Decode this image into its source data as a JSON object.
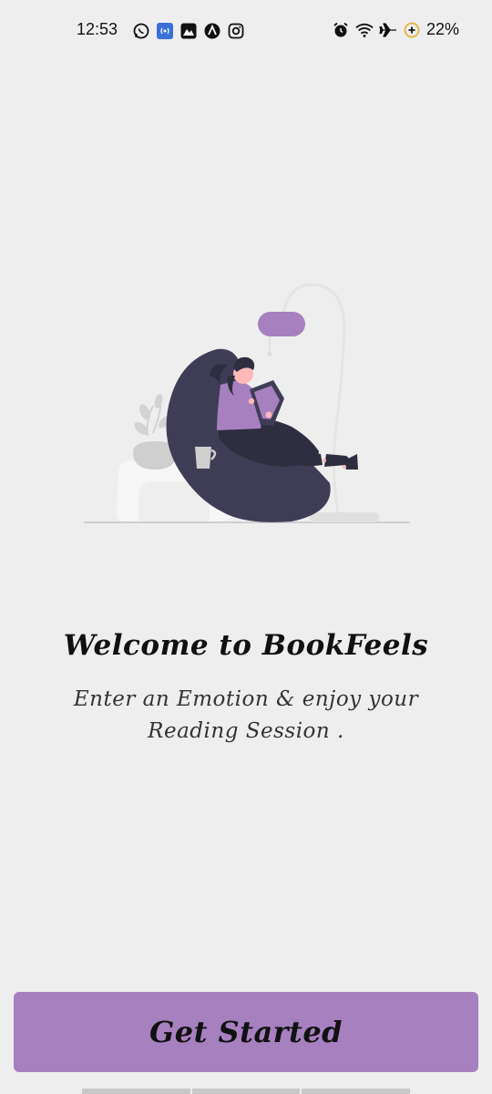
{
  "status_bar": {
    "time": "12:53",
    "left_icons": [
      "whatsapp-icon",
      "hotspot-icon",
      "gallery-icon",
      "nova-icon",
      "instagram-icon"
    ],
    "right_icons": [
      "alarm-icon",
      "wifi-icon",
      "airplane-icon",
      "battery-saver-icon"
    ],
    "battery": "22%"
  },
  "main": {
    "title": "Welcome to BookFeels",
    "subtitle": "Enter an Emotion & enjoy your Reading Session ."
  },
  "actions": {
    "get_started_label": "Get Started"
  },
  "colors": {
    "accent": "#a780c0",
    "background": "#eeeeee",
    "bean_bag": "#3f3d56"
  }
}
